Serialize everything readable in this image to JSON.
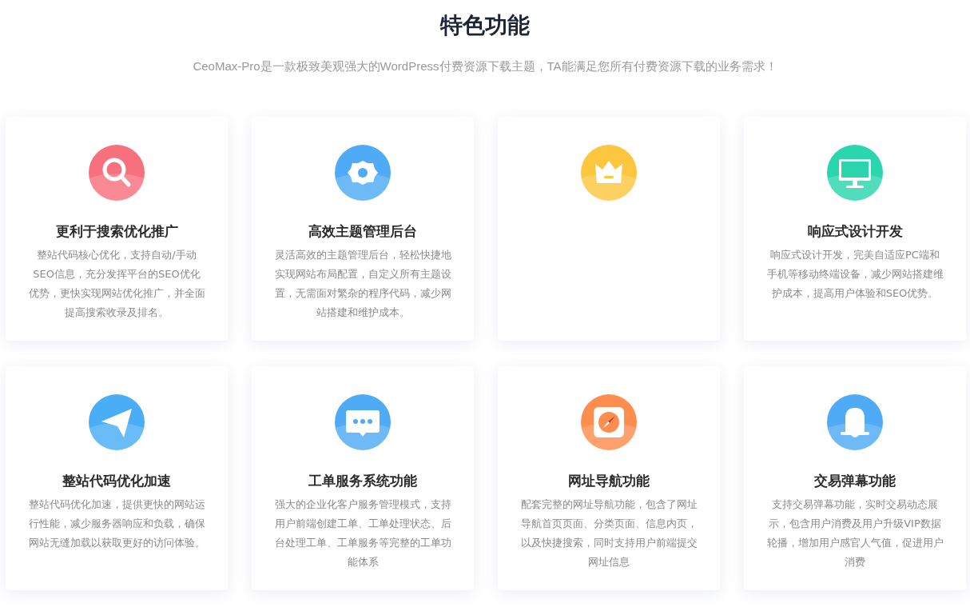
{
  "heading": {
    "title": "特色功能",
    "subtitle": "CeoMax-Pro是一款极致美观强大的WordPress付费资源下载主题，TA能满足您所有付费资源下载的业务需求！"
  },
  "features": [
    {
      "kind": "search",
      "color": "#f7707e",
      "title": "更利于搜索优化推广",
      "description": "整站代码核心优化，支持自动/手动SEO信息，充分发挥平台的SEO优化优势，更快实现网站优化推广，并全面提高搜索收录及排名。"
    },
    {
      "kind": "gear",
      "color": "#4fabf6",
      "title": "高效主题管理后台",
      "description": "灵活高效的主题管理后台，轻松快捷地实现网站布局配置，自定义所有主题设置，无需面对繁杂的程序代码，减少网站搭建和维护成本。"
    },
    {
      "kind": "crown",
      "color": "#fcc63f"
    },
    {
      "kind": "monitor",
      "color": "#2bd5ad",
      "title": "响应式设计开发",
      "description": "响应式设计开发，完美自适应PC端和手机等移动终端设备，减少网站搭建维护成本，提高用户体验和SEO优势。"
    },
    {
      "kind": "plane",
      "color": "#4aaef7",
      "title": "整站代码优化加速",
      "description": "整站代码优化加速，提供更快的网站运行性能，减少服务器响应和负载，确保网站无缝加载以获取更好的访问体验。"
    },
    {
      "kind": "chat",
      "color": "#4fabf6",
      "title": "工单服务系统功能",
      "description": "强大的企业化客户服务管理模式，支持用户前端创建工单、工单处理状态、后台处理工单、工单服务等完整的工单功能体系"
    },
    {
      "kind": "compass",
      "color": "#ff8d4e",
      "title": "网址导航功能",
      "description": "配套完整的网址导航功能，包含了网址导航首页页面、分类页面、信息内页，以及快捷搜索，同时支持用户前端提交网址信息"
    },
    {
      "kind": "bell",
      "color": "#4fabf6",
      "title": "交易弹幕功能",
      "description": "支持交易弹幕功能，实时交易动态展示，包含用户消费及用户升级VIP数据轮播，增加用户感官人气值，促进用户消费"
    }
  ]
}
